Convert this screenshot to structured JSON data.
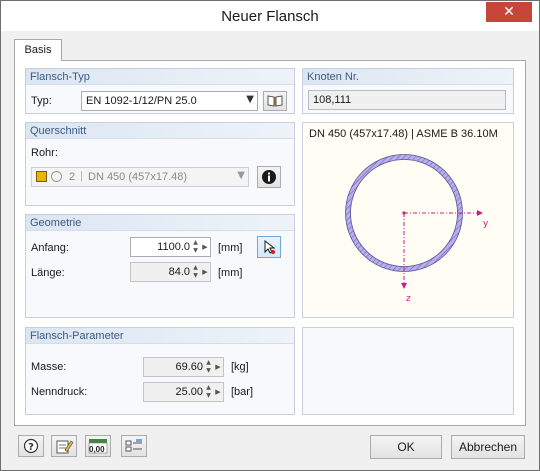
{
  "window": {
    "title": "Neuer Flansch",
    "close_glyph": "✕"
  },
  "tabs": [
    {
      "label": "Basis"
    }
  ],
  "flansch_typ": {
    "header": "Flansch-Typ",
    "typ_label": "Typ:",
    "typ_value": "EN 1092-1/12/PN 25.0",
    "library_icon": "book-icon"
  },
  "querschnitt": {
    "header": "Querschnitt",
    "rohr_label": "Rohr:",
    "rohr_number": "2",
    "rohr_value": "DN 450 (457x17.48)",
    "info_icon": "info-icon",
    "color_swatch": "#e8b400"
  },
  "geometrie": {
    "header": "Geometrie",
    "anfang_label": "Anfang:",
    "anfang_value": "1100.0",
    "anfang_unit": "[mm]",
    "laenge_label": "Länge:",
    "laenge_value": "84.0",
    "laenge_unit": "[mm]",
    "pick_icon": "pick-point-icon"
  },
  "knoten": {
    "header": "Knoten Nr.",
    "value": "108,111"
  },
  "preview": {
    "caption": "DN 450 (457x17.48) | ASME B 36.10M",
    "axis_y": "y",
    "axis_z": "z",
    "ring_color": "#7d74c9",
    "axis_color": "#d01c8b"
  },
  "parameter": {
    "header": "Flansch-Parameter",
    "masse_label": "Masse:",
    "masse_value": "69.60",
    "masse_unit": "[kg]",
    "nenndruck_label": "Nenndruck:",
    "nenndruck_value": "25.00",
    "nenndruck_unit": "[bar]"
  },
  "footer": {
    "ok": "OK",
    "cancel": "Abbrechen",
    "units_icon_text": "0,00"
  }
}
